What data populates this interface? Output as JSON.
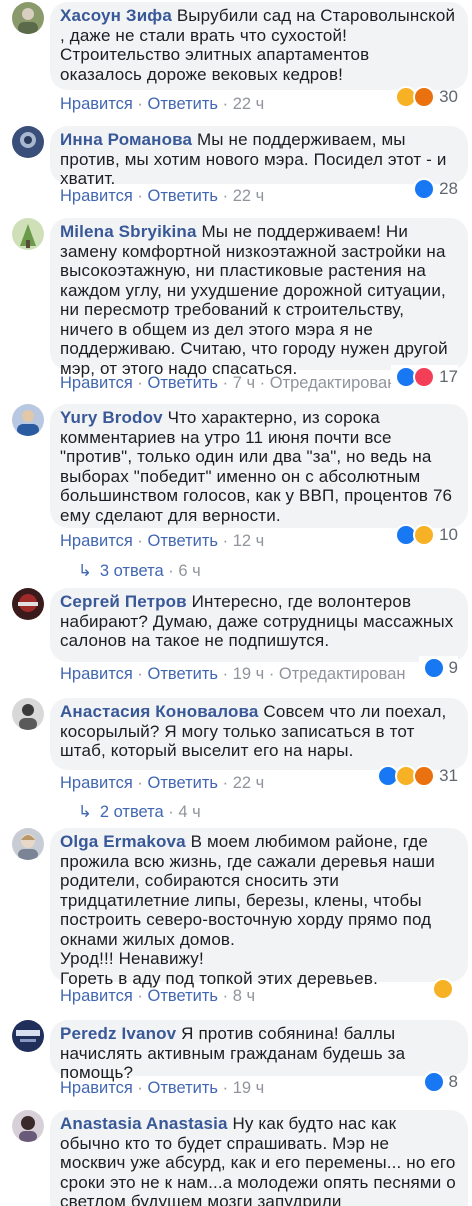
{
  "comments": [
    {
      "author": "Хасоун Зифа",
      "text": "Вырубили сад на Староволынской , даже не стали врать что сухостой! Строительство элитных апартаментов оказалось дороже вековых кедров!",
      "like_label": "Нравится",
      "reply_label": "Ответить",
      "time": "22 ч",
      "reactions": [
        "haha",
        "angry"
      ],
      "reaction_count": "30",
      "avatar_color": "#8a9a6a"
    },
    {
      "author": "Инна Романова",
      "text": "Мы не поддерживаем, мы против, мы хотим нового мэра. Посидел этот - и хватит.",
      "like_label": "Нравится",
      "reply_label": "Ответить",
      "time": "22 ч",
      "reactions": [
        "like"
      ],
      "reaction_count": "28",
      "avatar_color": "#3a4e7a"
    },
    {
      "author": "Milena Sbryikina",
      "text": "Мы не поддерживаем! Ни замену комфортной низкоэтажной застройки на высокоэтажную, ни пластиковые растения на каждом углу, ни ухудшение дорожной ситуации, ни пересмотр требований к строительству, ничего в общем из дел этого мэра я не поддерживаю. Считаю, что городу нужен другой мэр, от этого надо спасаться.",
      "like_label": "Нравится",
      "reply_label": "Ответить",
      "time": "7 ч",
      "edited": "Отредактировано",
      "reactions": [
        "like",
        "love"
      ],
      "reaction_count": "17",
      "avatar_color": "#9ab47a"
    },
    {
      "author": "Yury Brodov",
      "text": "Что характерно, из сорока комментариев на утро 11 июня почти все \"против\", только один или два \"за\", но ведь на выборах \"победит\" именно он с абсолютным большинством голосов, как у ВВП, процентов 76 ему сделают для верности.",
      "like_label": "Нравится",
      "reply_label": "Ответить",
      "time": "12 ч",
      "reactions": [
        "like",
        "sad"
      ],
      "reaction_count": "10",
      "replies_label": "3 ответа",
      "replies_time": "6 ч",
      "avatar_color": "#4a6a9a"
    },
    {
      "author": "Сергей Петров",
      "text": "Интересно, где волонтеров набирают? Думаю, даже сотрудницы массажных салонов на такое не подпишутся.",
      "like_label": "Нравится",
      "reply_label": "Ответить",
      "time": "19 ч",
      "edited": "Отредактирован",
      "reactions": [
        "like"
      ],
      "reaction_count": "9",
      "avatar_color": "#7a2a2a"
    },
    {
      "author": "Анастасия Коновалова",
      "text": "Совсем что ли поехал, косорылый? Я могу только записаться в тот штаб, который выселит его на нары.",
      "like_label": "Нравится",
      "reply_label": "Ответить",
      "time": "22 ч",
      "reactions": [
        "like",
        "haha",
        "angry"
      ],
      "reaction_count": "31",
      "replies_label": "2 ответа",
      "replies_time": "4 ч",
      "avatar_color": "#5a5a5a"
    },
    {
      "author": "Olga Ermakova",
      "text": "В моем любимом районе, где прожила всю жизнь, где сажали деревья наши родители, собираются сносить эти тридцатилетние липы, березы, клены, чтобы построить северо-восточную хорду прямо под окнами жилых домов.\nУрод!!! Ненавижу!\nГореть в аду под топкой этих деревьев.",
      "like_label": "Нравится",
      "reply_label": "Ответить",
      "time": "8 ч",
      "reactions": [
        "sad"
      ],
      "reaction_count": "",
      "avatar_color": "#9aa3b0"
    },
    {
      "author": "Peredz Ivanov",
      "text": "Я против собянина! баллы начислять активным гражданам будешь за помощь?",
      "like_label": "Нравится",
      "reply_label": "Ответить",
      "time": "19 ч",
      "reactions": [
        "like"
      ],
      "reaction_count": "8",
      "avatar_color": "#1f2f5a"
    },
    {
      "author": "Anastasia Anastasia",
      "text": "Ну как будто нас как обычно кто то будет спрашивать. Мэр не москвич уже абсурд, как и его перемены... но его сроки это не к нам...а молодежи опять песнями о светлом будущем мозги запудрили",
      "avatar_color": "#6a5a7a"
    }
  ]
}
